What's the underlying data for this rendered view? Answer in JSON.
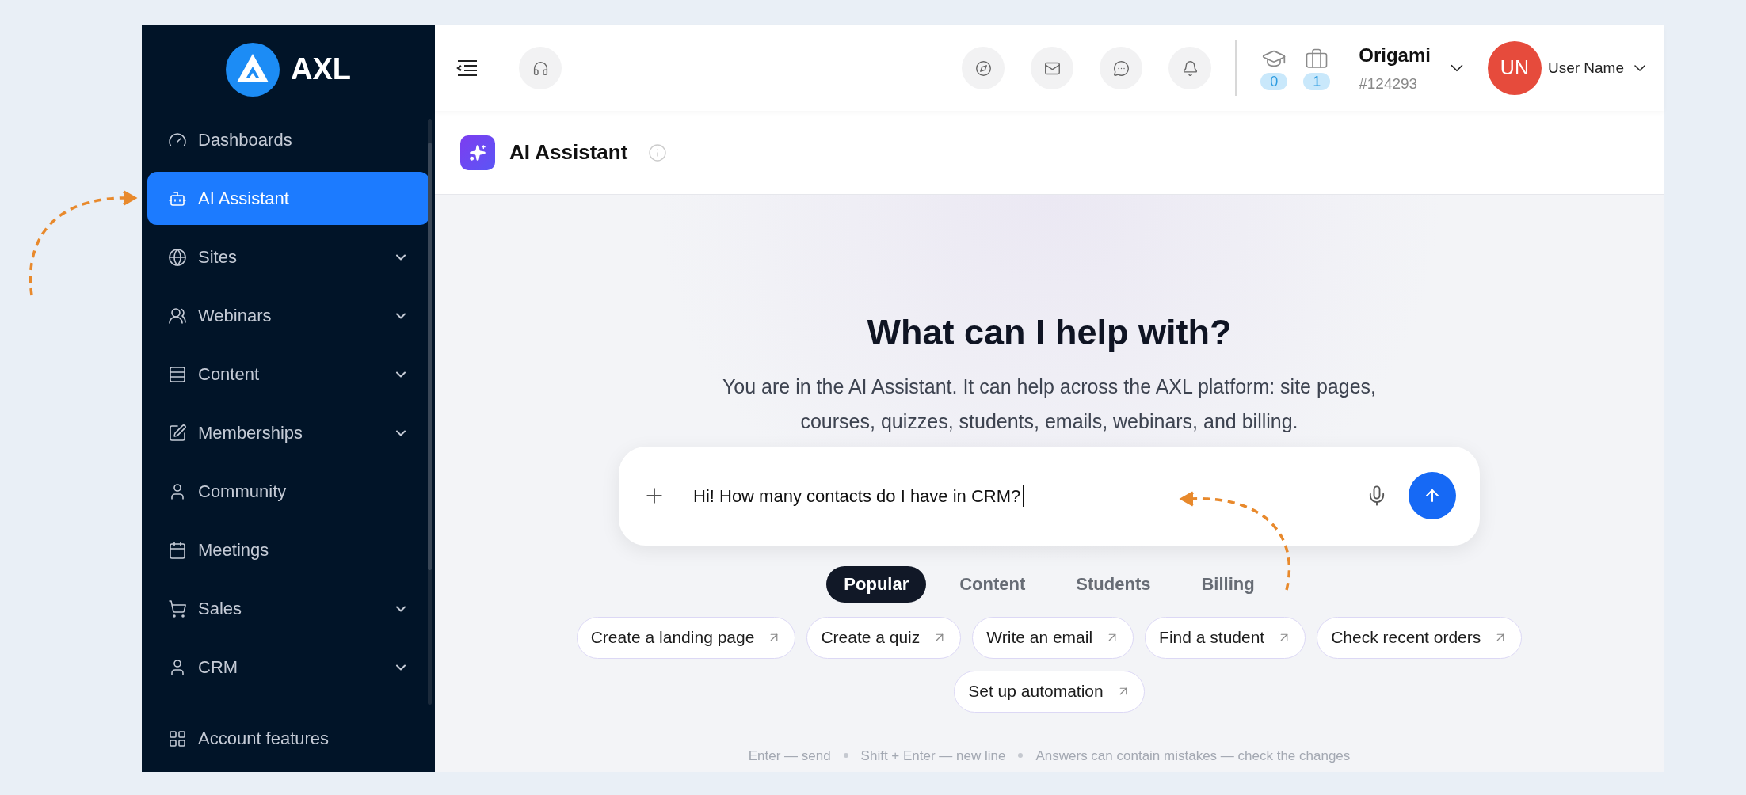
{
  "sidebar": {
    "logo": "AXL",
    "items": [
      {
        "label": "Dashboards",
        "selected": false,
        "has_submenu": false
      },
      {
        "label": "AI Assistant",
        "selected": true,
        "has_submenu": false
      },
      {
        "label": "Sites",
        "selected": false,
        "has_submenu": true
      },
      {
        "label": "Webinars",
        "selected": false,
        "has_submenu": true
      },
      {
        "label": "Content",
        "selected": false,
        "has_submenu": true
      },
      {
        "label": "Memberships",
        "selected": false,
        "has_submenu": true
      },
      {
        "label": "Community",
        "selected": false,
        "has_submenu": false
      },
      {
        "label": "Meetings",
        "selected": false,
        "has_submenu": false
      },
      {
        "label": "Sales",
        "selected": false,
        "has_submenu": true
      },
      {
        "label": "CRM",
        "selected": false,
        "has_submenu": true
      }
    ],
    "footer_item": {
      "label": "Account features",
      "selected": false
    }
  },
  "topbar": {
    "counters": [
      "0",
      "1"
    ],
    "workspace": {
      "name": "Origami",
      "id": "#124293"
    },
    "user": {
      "initials": "UN",
      "name": "User Name"
    }
  },
  "header": {
    "title": "AI Assistant"
  },
  "hero": {
    "heading": "What can I help with?",
    "description": "You are in the AI Assistant. It can help across the AXL platform: site pages, courses, quizzes, students, emails, webinars, and billing."
  },
  "composer": {
    "value": "Hi! How many contacts do I have in CRM?"
  },
  "tabs": [
    {
      "label": "Popular",
      "selected": true
    },
    {
      "label": "Content",
      "selected": false
    },
    {
      "label": "Students",
      "selected": false
    },
    {
      "label": "Billing",
      "selected": false
    }
  ],
  "suggestions": [
    "Create a landing page",
    "Create a quiz",
    "Write an email",
    "Find a student",
    "Check recent orders",
    "Set up automation"
  ],
  "hints": [
    "Enter — send",
    "Shift + Enter — new line",
    "Answers can contain mistakes — check the changes"
  ]
}
